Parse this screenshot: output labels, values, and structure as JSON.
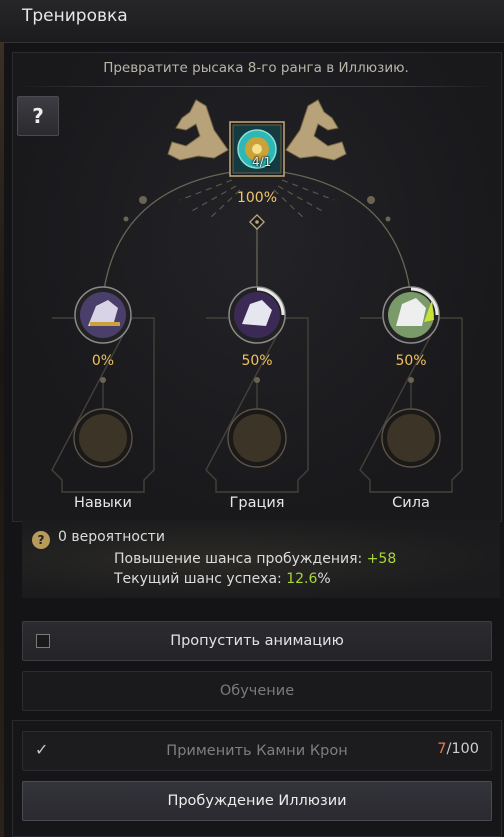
{
  "window": {
    "title": "Тренировка"
  },
  "subtitle": "Превратите рысака 8-го ранга в Иллюзию.",
  "help_button": "?",
  "center": {
    "count": "4/1",
    "percent": "100%"
  },
  "stats": [
    {
      "label": "Навыки",
      "percent": "0%"
    },
    {
      "label": "Грация",
      "percent": "50%"
    },
    {
      "label": "Сила",
      "percent": "50%"
    }
  ],
  "info": {
    "icon": "?",
    "title": "0 вероятности",
    "boost_label": "Повышение шанса пробуждения: ",
    "boost_value": "+58",
    "chance_label": "Текущий шанс успеха: ",
    "chance_value": "12.6",
    "chance_unit": "%"
  },
  "buttons": {
    "skip_animation": "Пропустить анимацию",
    "training": "Обучение",
    "apply_stones": "Применить Камни Крон",
    "awaken": "Пробуждение Иллюзии"
  },
  "stones": {
    "current": "7",
    "max": "/100"
  },
  "colors": {
    "accent_gold": "#f0c060",
    "green": "#a6d83a",
    "stone_count": "#e8784a"
  }
}
